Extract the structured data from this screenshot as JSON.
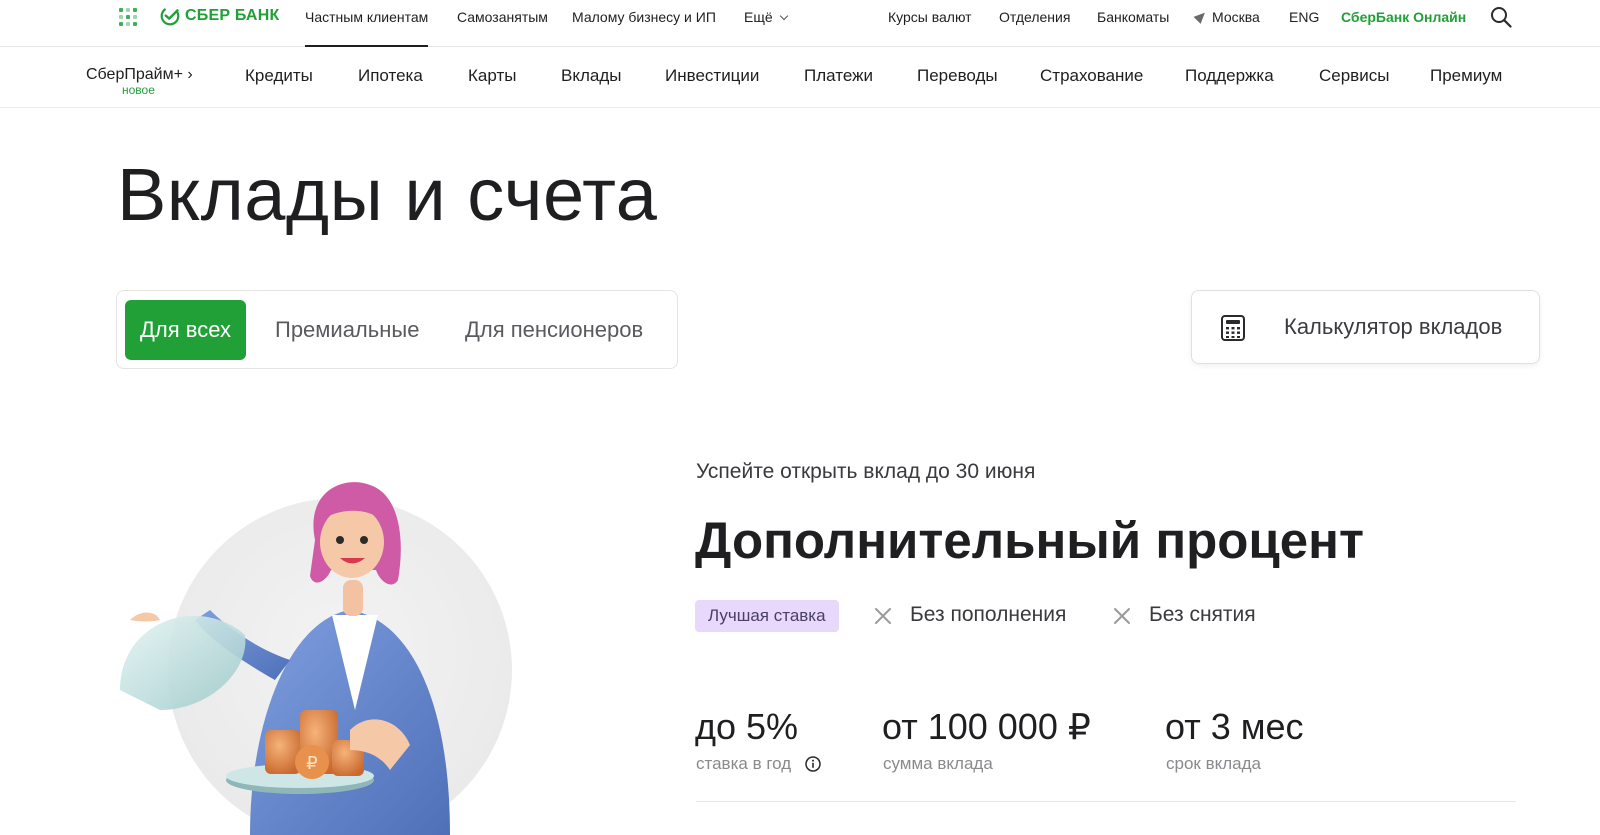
{
  "brand": {
    "name": "СБЕР БАНК",
    "color": "#21a038"
  },
  "top_nav": {
    "segments": [
      "Частным клиентам",
      "Самозанятым",
      "Малому бизнесу и ИП",
      "Ещё"
    ],
    "links": [
      "Курсы валют",
      "Отделения",
      "Банкоматы"
    ],
    "city": "Москва",
    "language": "ENG",
    "online": "СберБанк Онлайн"
  },
  "main_nav": {
    "prime": "СберПрайм+ ›",
    "prime_badge": "новое",
    "items": [
      "Кредиты",
      "Ипотека",
      "Карты",
      "Вклады",
      "Инвестиции",
      "Платежи",
      "Переводы",
      "Страхование",
      "Поддержка",
      "Сервисы",
      "Премиум"
    ]
  },
  "page": {
    "title": "Вклады и счета"
  },
  "tabs": [
    "Для всех",
    "Премиальные",
    "Для пенсионеров"
  ],
  "calculator": {
    "label": "Калькулятор вкладов"
  },
  "promo": {
    "kicker": "Успейте открыть вклад до 30 июня",
    "title": "Дополнительный процент",
    "tag": "Лучшая ставка",
    "features": [
      "Без пополнения",
      "Без снятия"
    ],
    "stats": [
      {
        "value": "до 5%",
        "caption": "ставка в год"
      },
      {
        "value": "от 100 000 ₽",
        "caption": "сумма вклада"
      },
      {
        "value": "от 3 мес",
        "caption": "срок вклада"
      }
    ]
  },
  "colors": {
    "accent": "#21a038",
    "tag_bg": "#e8d8fb",
    "text": "#1f1f22",
    "muted": "#8a8a8e"
  }
}
